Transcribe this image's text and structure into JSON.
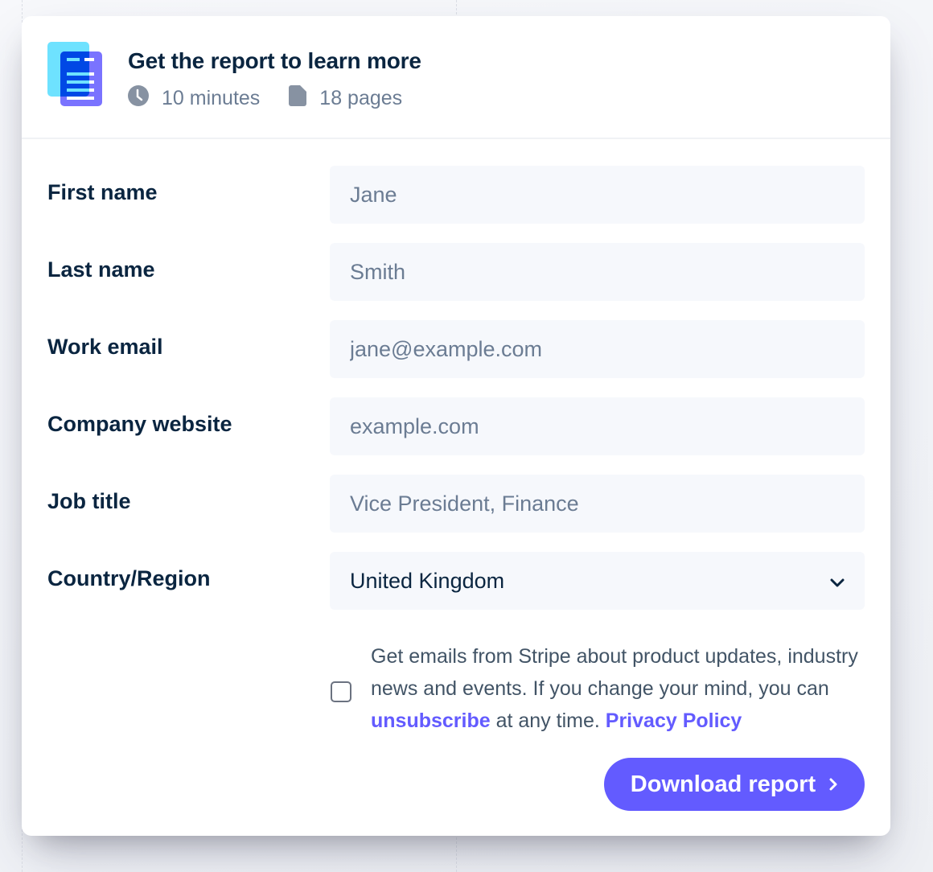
{
  "header": {
    "title": "Get the report to learn more",
    "icon": "document-icon",
    "meta": [
      {
        "icon": "clock-icon",
        "text": "10 minutes"
      },
      {
        "icon": "file-icon",
        "text": "18 pages"
      }
    ]
  },
  "form": {
    "fields": [
      {
        "label": "First name",
        "placeholder": "Jane",
        "value": ""
      },
      {
        "label": "Last name",
        "placeholder": "Smith",
        "value": ""
      },
      {
        "label": "Work email",
        "placeholder": "jane@example.com",
        "value": ""
      },
      {
        "label": "Company website",
        "placeholder": "example.com",
        "value": ""
      },
      {
        "label": "Job title",
        "placeholder": "Vice President, Finance",
        "value": ""
      }
    ],
    "country": {
      "label": "Country/Region",
      "selected": "United Kingdom",
      "icon": "chevron-down-icon"
    },
    "consent": {
      "checked": false,
      "text_before": "Get emails from Stripe about product updates, industry news and events. If you change your mind, you can ",
      "unsubscribe_link": "unsubscribe",
      "text_after": " at any time. ",
      "privacy_link": "Privacy Policy"
    },
    "submit": {
      "label": "Download report",
      "icon": "chevron-right-icon"
    }
  },
  "colors": {
    "accent": "#635bff",
    "heading": "#0a2540",
    "muted": "#6b7c93",
    "field_bg": "#f6f8fc"
  }
}
